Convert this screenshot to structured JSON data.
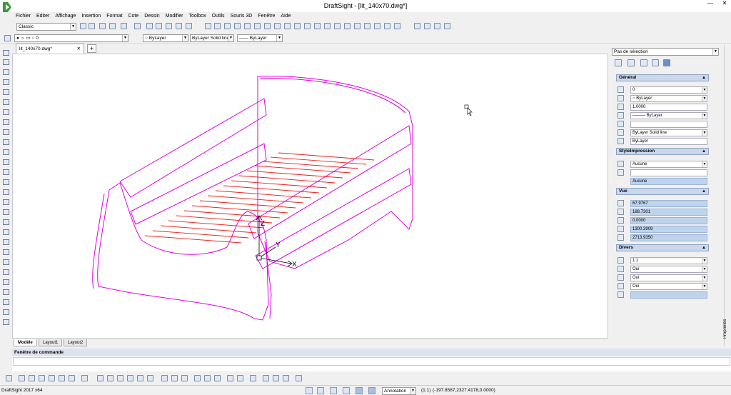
{
  "window": {
    "title": "DraftSight - [lit_140x70.dwg*]",
    "minimize": "—",
    "maximize": "□",
    "close": "✕"
  },
  "menu": {
    "items": [
      "Fichier",
      "Editer",
      "Affichage",
      "Insertion",
      "Format",
      "Cote",
      "Dessin",
      "Modifier",
      "Toolbox",
      "Outils",
      "Souris 3D",
      "Fenêtre",
      "Aide"
    ]
  },
  "toolbar1": {
    "workspace": "Classic"
  },
  "toolbar2": {
    "layer": "0",
    "color": "ByLayer",
    "linetype": "ByLayer",
    "linetype_desc": "Solid line",
    "lineweight": "—— ByLayer"
  },
  "document": {
    "tab_label": "lit_140x70.dwg*",
    "close": "✕",
    "new_tab": "+"
  },
  "layout_tabs": [
    "Modèle",
    "Layout1",
    "Layout2"
  ],
  "axes": {
    "x": "X",
    "y": "Y",
    "z": "Z"
  },
  "command": {
    "title": "Fenêtre de commande"
  },
  "status": {
    "app_version": "DraftSight 2017 x64",
    "annotation": "Annotation",
    "scale": "(1:1)",
    "coords": "(-197.8587,2327.4178,0.0000)"
  },
  "properties": {
    "selection": "Pas de sélection",
    "sections": {
      "general": "Général",
      "print_style": "StyleImpression",
      "view": "Vue",
      "misc": "Divers"
    },
    "general": {
      "layer": "0",
      "color": "ByLayer",
      "lt_scale": "1.0000",
      "linetype": "——— ByLayer",
      "thickness": "",
      "linetype_display": "ByLayer    Solid line",
      "lineweight": "ByLayer"
    },
    "print_style": {
      "style": "Aucune",
      "table": "",
      "table_attached": "Aucune"
    },
    "view": {
      "center_x": "67.9767",
      "center_y": "188.7301",
      "center_z": "0.0000",
      "height": "1300.3909",
      "width": "2713.9350"
    },
    "misc": {
      "annotation_scale": "1:1",
      "ucs_icon_on": "Oui",
      "ucs_icon_origin": "Oui",
      "ucs_per_viewport": "Oui",
      "ucs_name": ""
    },
    "vertical_tab": "Propriétés"
  },
  "colors": {
    "accent": "#e000e0",
    "slats": "#e8201c",
    "panel_header": "#cbd7ea"
  }
}
